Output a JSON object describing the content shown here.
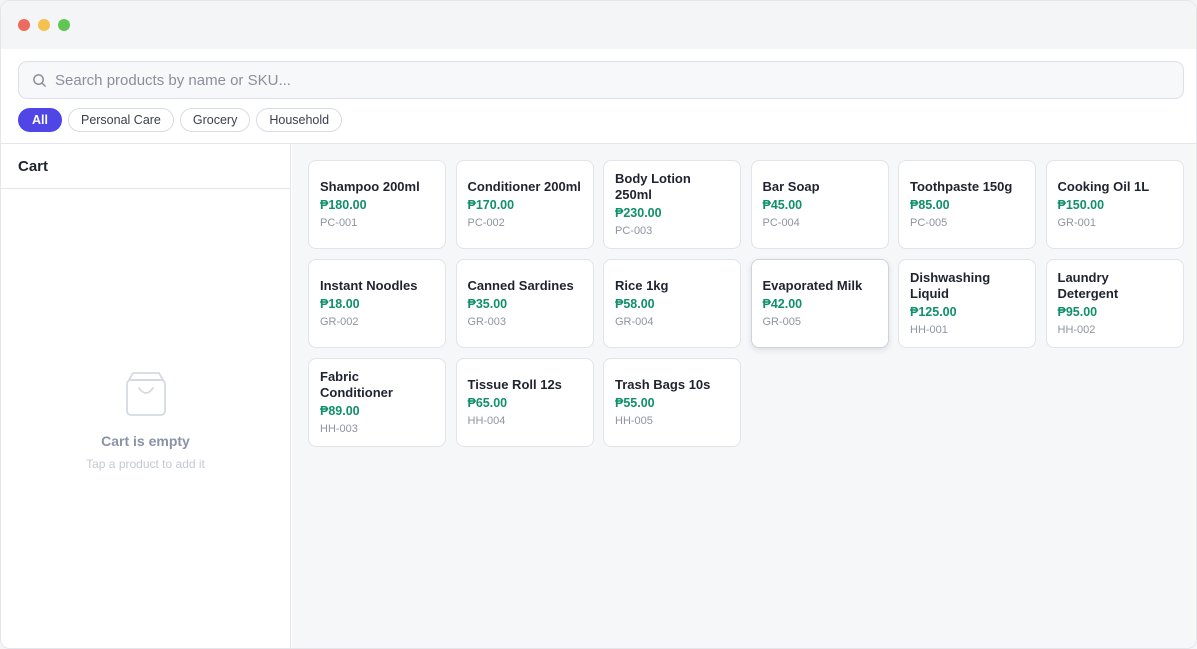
{
  "search": {
    "placeholder": "Search products by name or SKU..."
  },
  "filters": [
    {
      "label": "All",
      "active": true
    },
    {
      "label": "Personal Care",
      "active": false
    },
    {
      "label": "Grocery",
      "active": false
    },
    {
      "label": "Household",
      "active": false
    }
  ],
  "cart": {
    "title": "Cart",
    "empty_title": "Cart is empty",
    "empty_subtitle": "Tap a product to add it",
    "empty_icon": "shopping-bag-icon"
  },
  "products": [
    {
      "name": "Shampoo 200ml",
      "price": "₱180.00",
      "sku": "PC-001"
    },
    {
      "name": "Conditioner 200ml",
      "price": "₱170.00",
      "sku": "PC-002"
    },
    {
      "name": "Body Lotion 250ml",
      "price": "₱230.00",
      "sku": "PC-003"
    },
    {
      "name": "Bar Soap",
      "price": "₱45.00",
      "sku": "PC-004"
    },
    {
      "name": "Toothpaste 150g",
      "price": "₱85.00",
      "sku": "PC-005"
    },
    {
      "name": "Cooking Oil 1L",
      "price": "₱150.00",
      "sku": "GR-001"
    },
    {
      "name": "Instant Noodles",
      "price": "₱18.00",
      "sku": "GR-002"
    },
    {
      "name": "Canned Sardines",
      "price": "₱35.00",
      "sku": "GR-003"
    },
    {
      "name": "Rice 1kg",
      "price": "₱58.00",
      "sku": "GR-004"
    },
    {
      "name": "Evaporated Milk",
      "price": "₱42.00",
      "sku": "GR-005",
      "hovered": true
    },
    {
      "name": "Dishwashing Liquid",
      "price": "₱125.00",
      "sku": "HH-001"
    },
    {
      "name": "Laundry Detergent",
      "price": "₱95.00",
      "sku": "HH-002"
    },
    {
      "name": "Fabric Conditioner",
      "price": "₱89.00",
      "sku": "HH-003"
    },
    {
      "name": "Tissue Roll 12s",
      "price": "₱65.00",
      "sku": "HH-004"
    },
    {
      "name": "Trash Bags 10s",
      "price": "₱55.00",
      "sku": "HH-005"
    }
  ],
  "colors": {
    "accent": "#4f46e5",
    "price": "#0f8f6a",
    "window_red": "#ec6a5e",
    "window_yellow": "#f4c04f",
    "window_green": "#61c554"
  }
}
